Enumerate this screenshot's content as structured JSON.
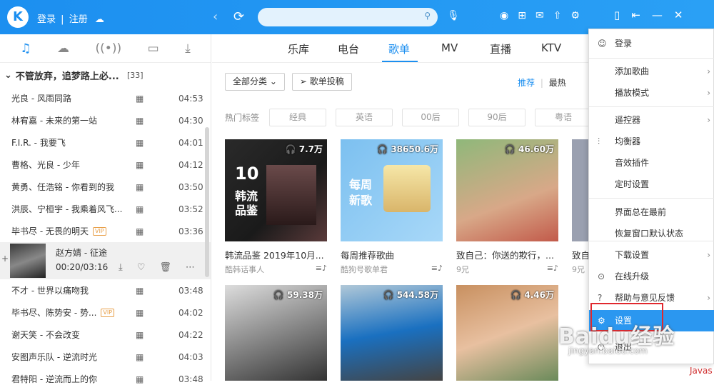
{
  "header": {
    "auth_login": "登录",
    "auth_sep": "|",
    "auth_register": "注册"
  },
  "left": {
    "playlist_title": "不管放弃，追梦路上必...",
    "playlist_count": "[33]",
    "songs_top": [
      {
        "title": "光良 - 风雨同路",
        "dur": "04:53",
        "vip": false
      },
      {
        "title": "林宥嘉 - 未来的第一站",
        "dur": "04:30",
        "vip": false
      },
      {
        "title": "F.I.R. - 我要飞",
        "dur": "04:01",
        "vip": false
      },
      {
        "title": "曹格、光良 - 少年",
        "dur": "04:12",
        "vip": false
      },
      {
        "title": "黄勇、任浩铭 - 你看到的我",
        "dur": "03:50",
        "vip": false
      },
      {
        "title": "洪辰、宁桓宇 - 我乘着风飞...",
        "dur": "03:52",
        "vip": false
      },
      {
        "title": "毕书尽 - 无畏的明天",
        "dur": "03:36",
        "vip": true
      }
    ],
    "now_playing": {
      "title": "赵方婧 - 征途",
      "time": "00:20/03:16"
    },
    "songs_bottom": [
      {
        "title": "不才 - 世界以痛吻我",
        "dur": "03:48",
        "vip": false
      },
      {
        "title": "毕书尽、陈势安 - 势...",
        "dur": "04:02",
        "vip": true
      },
      {
        "title": "谢天笑 - 不会改变",
        "dur": "04:22",
        "vip": false
      },
      {
        "title": "安图声乐队 - 逆流时光",
        "dur": "04:03",
        "vip": false
      },
      {
        "title": "君特阳 - 逆流而上的你",
        "dur": "03:48",
        "vip": false
      }
    ],
    "vip_label": "VIP"
  },
  "main": {
    "tabs": [
      "乐库",
      "电台",
      "歌单",
      "MV",
      "直播",
      "KTV"
    ],
    "active_tab": "歌单",
    "category_btn": "全部分类",
    "submit_btn": "歌单投稿",
    "sort_recommend": "推荐",
    "sort_latest": "最热",
    "tags_label": "热门标签",
    "tags": [
      "经典",
      "英语",
      "00后",
      "90后",
      "粤语"
    ],
    "cards_row1": [
      {
        "plays": "7.7万",
        "title": "韩流品鉴 2019年10月...",
        "author": "酷韩话事人"
      },
      {
        "plays": "38650.6万",
        "title": "每周推荐歌曲",
        "author": "酷狗号歌单君"
      },
      {
        "plays": "46.60万",
        "title": "致自己：你送的欺行，...",
        "author": "9兄"
      },
      {
        "plays": "",
        "title": "致自",
        "author": "9兄"
      }
    ],
    "cards_row2": [
      {
        "plays": "59.38万"
      },
      {
        "plays": "544.58万"
      },
      {
        "plays": "4.46万"
      }
    ],
    "overlay1": {
      "big": "10",
      "l1": "韩流",
      "l2": "品鉴"
    },
    "overlay2": {
      "l1": "每周",
      "l2": "新歌"
    }
  },
  "menu": {
    "items": [
      "登录",
      "添加歌曲",
      "播放模式",
      "遥控器",
      "均衡器",
      "音效插件",
      "定时设置",
      "界面总在最前",
      "恢复窗口默认状态",
      "下载设置",
      "在线升级",
      "帮助与意见反馈",
      "设置",
      "退出"
    ]
  },
  "watermark": {
    "main": "Baidu经验",
    "sub": "jingyan.baidu.com"
  },
  "corner": "Javas"
}
